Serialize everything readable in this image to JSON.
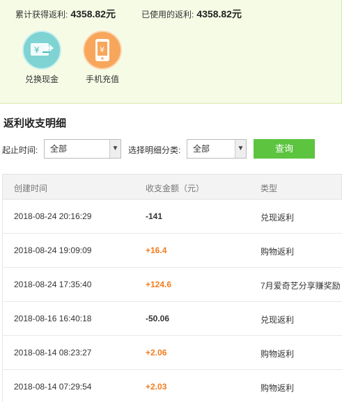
{
  "summary": {
    "total_label": "累计获得返利:",
    "total_value": "4358.82元",
    "used_label": "已使用的返利:",
    "used_value": "4358.82元",
    "actions": [
      {
        "label": "兑换现金",
        "icon": "cash-exchange-icon",
        "color": "#7fd3d3"
      },
      {
        "label": "手机充值",
        "icon": "phone-recharge-icon",
        "color": "#f7a65b"
      }
    ]
  },
  "section_title": "返利收支明细",
  "filters": {
    "time_label": "起止时间:",
    "time_value": "全部",
    "category_label": "选择明细分类:",
    "category_value": "全部",
    "query_label": "查询"
  },
  "table": {
    "headers": [
      "创建时间",
      "收支金额（元）",
      "类型"
    ],
    "rows": [
      {
        "time": "2018-08-24 20:16:29",
        "amount": "-141",
        "type": "兑现返利",
        "sign": "neg"
      },
      {
        "time": "2018-08-24 19:09:09",
        "amount": "+16.4",
        "type": "购物返利",
        "sign": "pos"
      },
      {
        "time": "2018-08-24 17:35:40",
        "amount": "+124.6",
        "type": "7月爱奇艺分享赚奖励",
        "sign": "pos"
      },
      {
        "time": "2018-08-16 16:40:18",
        "amount": "-50.06",
        "type": "兑现返利",
        "sign": "neg"
      },
      {
        "time": "2018-08-14 08:23:27",
        "amount": "+2.06",
        "type": "购物返利",
        "sign": "pos"
      },
      {
        "time": "2018-08-14 07:29:54",
        "amount": "+2.03",
        "type": "购物返利",
        "sign": "pos"
      }
    ]
  },
  "colors": {
    "accent_green": "#5cc43f",
    "positive": "#f07c1c",
    "panel_bg": "#f6fbe6"
  }
}
